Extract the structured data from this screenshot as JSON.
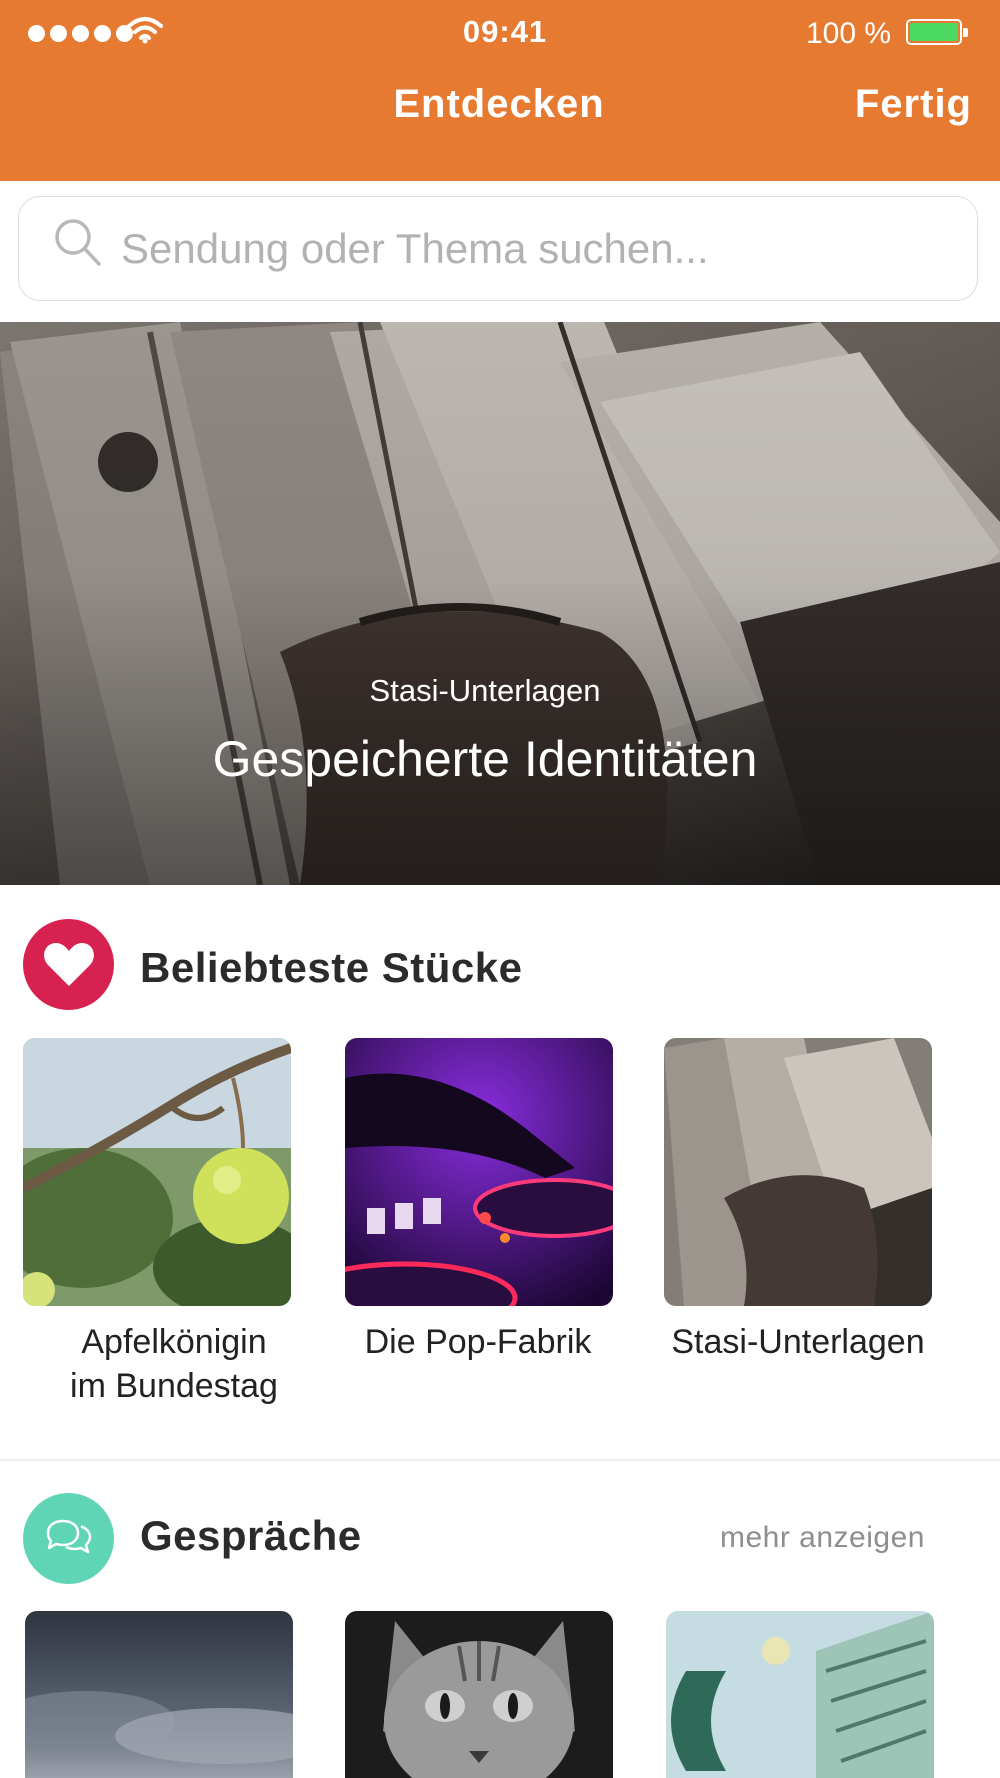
{
  "status_bar": {
    "time": "09:41",
    "battery_text": "100 %",
    "battery_color": "#4cd964"
  },
  "nav": {
    "title": "Entdecken",
    "done_label": "Fertig",
    "color": "#e67a30"
  },
  "search": {
    "placeholder": "Sendung oder Thema suchen...",
    "value": ""
  },
  "hero": {
    "subtitle": "Stasi-Unterlagen",
    "title": "Gespeicherte Identitäten"
  },
  "sections": [
    {
      "title": "Beliebteste Stücke",
      "icon": "heart-icon",
      "icon_color": "#d7214f",
      "items": [
        {
          "caption_lines": [
            "Apfelkönigin",
            "im Bundestag"
          ],
          "image": "apple-branch"
        },
        {
          "caption_lines": [
            "Die Pop-Fabrik"
          ],
          "image": "dj-mixer"
        },
        {
          "caption_lines": [
            "Stasi-Unterlagen"
          ],
          "image": "file-folders"
        }
      ]
    },
    {
      "title": "Gespräche",
      "icon": "chat-bubbles-icon",
      "icon_color": "#5fd5b5",
      "more_label": "mehr anzeigen",
      "items": [
        {
          "image": "cloudy-sky"
        },
        {
          "image": "cat-face"
        },
        {
          "image": "euro-banknote"
        }
      ]
    }
  ]
}
